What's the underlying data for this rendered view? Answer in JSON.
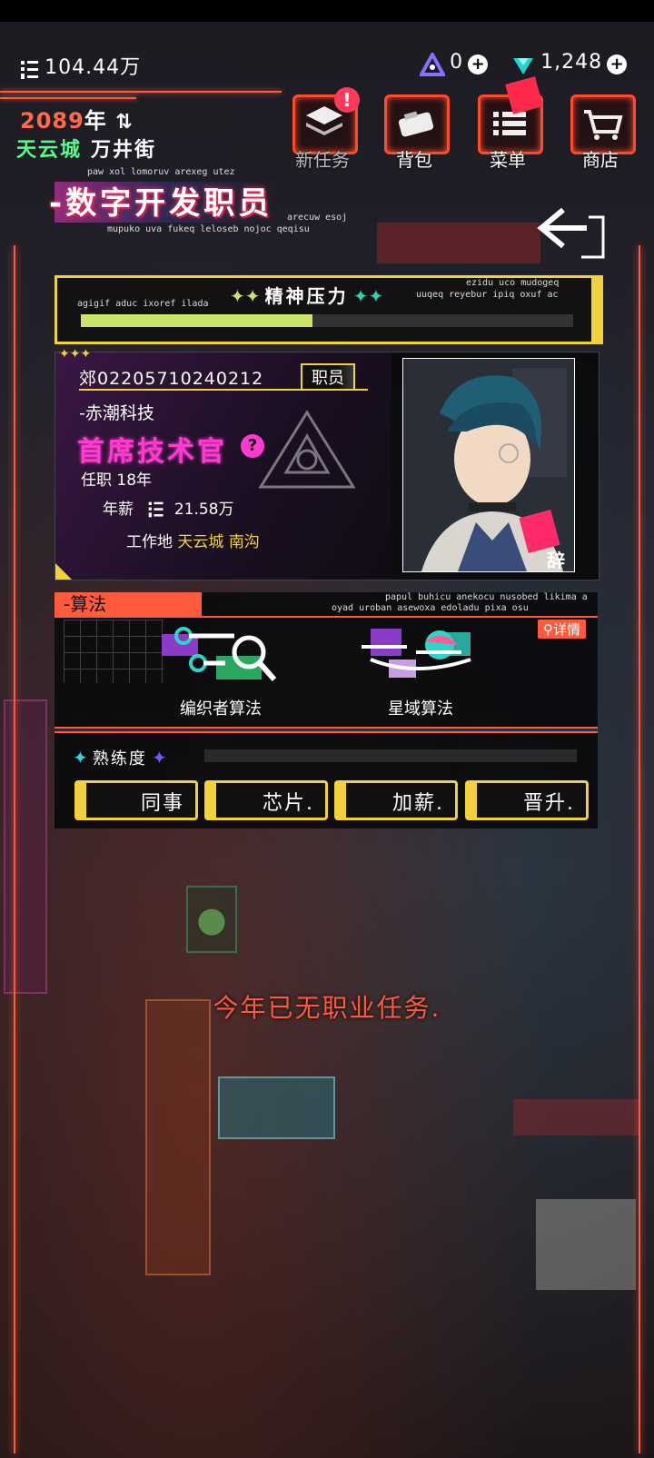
{
  "currency": {
    "money": "104.44万",
    "gems_a": "0",
    "gems_b": "1,248"
  },
  "header": {
    "year": "2089",
    "year_unit": "年",
    "city": "天云城",
    "street": "万井街",
    "cipher_top": "paw xol lomoruv arexeg utez",
    "job_title": "-数字开发职员",
    "cipher_a": "arecuw esoj",
    "cipher_b": "mupuko uva fukeq leloseb nojoc qeqisu"
  },
  "nav": {
    "tasks": "新任务",
    "bag": "背包",
    "menu": "菜单",
    "shop": "商店",
    "tasks_alert": "!"
  },
  "stress": {
    "title": "精神压力",
    "cipher_left": "agigif aduc ixoref ilada",
    "cipher_right_1": "ezidu uco mudogeq",
    "cipher_right_2": "uuqeq reyebur ipiq oxuf ac",
    "level": 0.47
  },
  "card": {
    "id": "郊02205710240212",
    "role_tag": "职员",
    "company": "-赤潮科技",
    "rank": "首席技术官",
    "tenure": "任职 18年",
    "salary_label": "年薪",
    "salary": "21.58万",
    "workplace_label": "工作地",
    "workplace_city": "天云城",
    "workplace_area": "南沟",
    "resign": "辞职"
  },
  "algorithms": {
    "tab": "-算法",
    "cipher_1": "papul buhicu anekocu nusobed likima a",
    "cipher_2": "oyad uroban asewoxa edoladu pixa osu",
    "detail": "详情",
    "items": [
      {
        "label": "编织者算法"
      },
      {
        "label": "星域算法"
      }
    ]
  },
  "proficiency": {
    "label": "熟练度",
    "level": 0
  },
  "actions": {
    "colleague": "同事",
    "chip": "芯片.",
    "raise": "加薪.",
    "promote": "晋升."
  },
  "notice": "今年已无职业任务.",
  "colors": {
    "accent": "#ff5a3c",
    "yellow": "#f2d23c",
    "magenta": "#ff3ad0",
    "green": "#53ff8a",
    "stress_bar": "#c8e56a"
  }
}
